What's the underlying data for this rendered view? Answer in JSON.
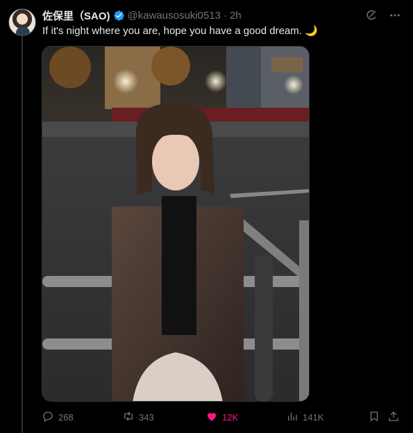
{
  "tweet": {
    "display_name": "佐保里（SAO)",
    "handle": "@kawausosuki0513",
    "separator": "·",
    "time": "2h",
    "text": "If it's night where you are, hope you have a good dream. 🌙",
    "verified": true
  },
  "icons": {
    "verified": "verified-badge-icon",
    "grok": "grok-icon",
    "more": "more-icon",
    "reply": "reply-icon",
    "retweet": "retweet-icon",
    "like": "heart-icon",
    "views": "views-icon",
    "bookmark": "bookmark-icon",
    "share": "share-icon"
  },
  "actions": {
    "replies": "268",
    "retweets": "343",
    "likes": "12K",
    "views": "141K"
  },
  "colors": {
    "background": "#000000",
    "text": "#e7e9ea",
    "muted": "#71767b",
    "verified": "#1d9bf0",
    "like": "#f91880"
  }
}
